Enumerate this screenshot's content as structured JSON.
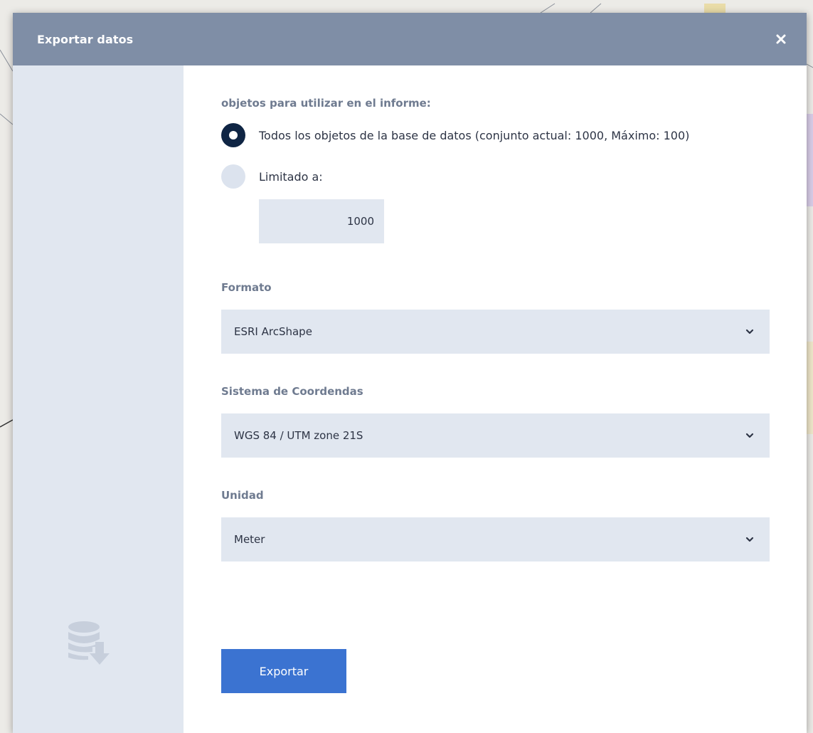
{
  "dialog": {
    "title": "Exportar datos",
    "close_icon": "close-icon"
  },
  "objects": {
    "label": "objetos para utilizar en el informe:",
    "options": [
      {
        "label": "Todos los objetos de la base de datos (conjunto actual: 1000, Máximo: 100)",
        "checked": true
      },
      {
        "label": "Limitado a:",
        "checked": false
      }
    ],
    "limit_value": "1000"
  },
  "format": {
    "label": "Formato",
    "selected": "ESRI ArcShape"
  },
  "crs": {
    "label": "Sistema de Coordendas",
    "selected": "WGS 84 / UTM zone 21S"
  },
  "unit": {
    "label": "Unidad",
    "selected": "Meter"
  },
  "actions": {
    "export_label": "Exportar"
  },
  "side_icon": "database-export-icon",
  "colors": {
    "header": "#7f8ea6",
    "side_panel": "#e1e7f0",
    "primary_button": "#3b73d1",
    "radio_checked": "#0f2544"
  }
}
